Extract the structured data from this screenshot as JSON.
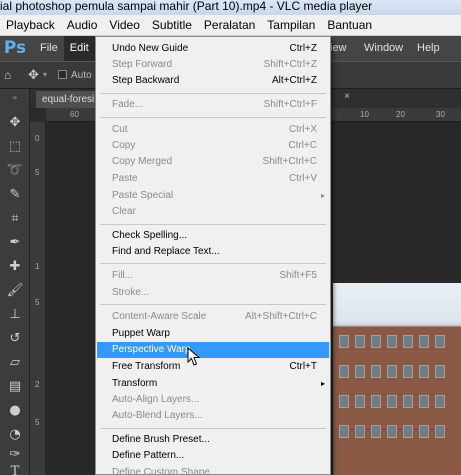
{
  "vlc": {
    "title": "ial photoshop pemula sampai mahir (Part 10).mp4 - VLC media player",
    "menu": [
      "Playback",
      "Audio",
      "Video",
      "Subtitle",
      "Peralatan",
      "Tampilan",
      "Bantuan"
    ]
  },
  "photoshop": {
    "logo": "Ps",
    "menu_left": [
      "File",
      "Edit"
    ],
    "menu_right": [
      "iew",
      "Window",
      "Help"
    ],
    "options_label": "Auto",
    "doc_tab": "equal-foresi",
    "ruler_h_ticks": [
      "60",
      "10",
      "20",
      "30"
    ],
    "ruler_v_ticks": [
      "0",
      "5",
      "1",
      "5",
      "2",
      "5"
    ]
  },
  "edit_menu": {
    "items": [
      {
        "label": "Undo New Guide",
        "shortcut": "Ctrl+Z",
        "disabled": false
      },
      {
        "label": "Step Forward",
        "shortcut": "Shift+Ctrl+Z",
        "disabled": true
      },
      {
        "label": "Step Backward",
        "shortcut": "Alt+Ctrl+Z",
        "disabled": false
      },
      {
        "label": "Fade...",
        "shortcut": "Shift+Ctrl+F",
        "disabled": true
      },
      {
        "label": "Cut",
        "shortcut": "Ctrl+X",
        "disabled": true
      },
      {
        "label": "Copy",
        "shortcut": "Ctrl+C",
        "disabled": true
      },
      {
        "label": "Copy Merged",
        "shortcut": "Shift+Ctrl+C",
        "disabled": true
      },
      {
        "label": "Paste",
        "shortcut": "Ctrl+V",
        "disabled": true
      },
      {
        "label": "Paste Special",
        "shortcut": "",
        "disabled": true,
        "submenu": true
      },
      {
        "label": "Clear",
        "shortcut": "",
        "disabled": true
      },
      {
        "label": "Check Spelling...",
        "shortcut": "",
        "disabled": false
      },
      {
        "label": "Find and Replace Text...",
        "shortcut": "",
        "disabled": false
      },
      {
        "label": "Fill...",
        "shortcut": "Shift+F5",
        "disabled": true
      },
      {
        "label": "Stroke...",
        "shortcut": "",
        "disabled": true
      },
      {
        "label": "Content-Aware Scale",
        "shortcut": "Alt+Shift+Ctrl+C",
        "disabled": true
      },
      {
        "label": "Puppet Warp",
        "shortcut": "",
        "disabled": false
      },
      {
        "label": "Perspective Warp",
        "shortcut": "",
        "disabled": false,
        "highlighted": true
      },
      {
        "label": "Free Transform",
        "shortcut": "Ctrl+T",
        "disabled": false
      },
      {
        "label": "Transform",
        "shortcut": "",
        "disabled": false,
        "submenu": true
      },
      {
        "label": "Auto-Align Layers...",
        "shortcut": "",
        "disabled": true
      },
      {
        "label": "Auto-Blend Layers...",
        "shortcut": "",
        "disabled": true
      },
      {
        "label": "Define Brush Preset...",
        "shortcut": "",
        "disabled": false
      },
      {
        "label": "Define Pattern...",
        "shortcut": "",
        "disabled": false
      },
      {
        "label": "Define Custom Shape...",
        "shortcut": "",
        "disabled": true
      }
    ],
    "submenu_arrow": "▸"
  }
}
